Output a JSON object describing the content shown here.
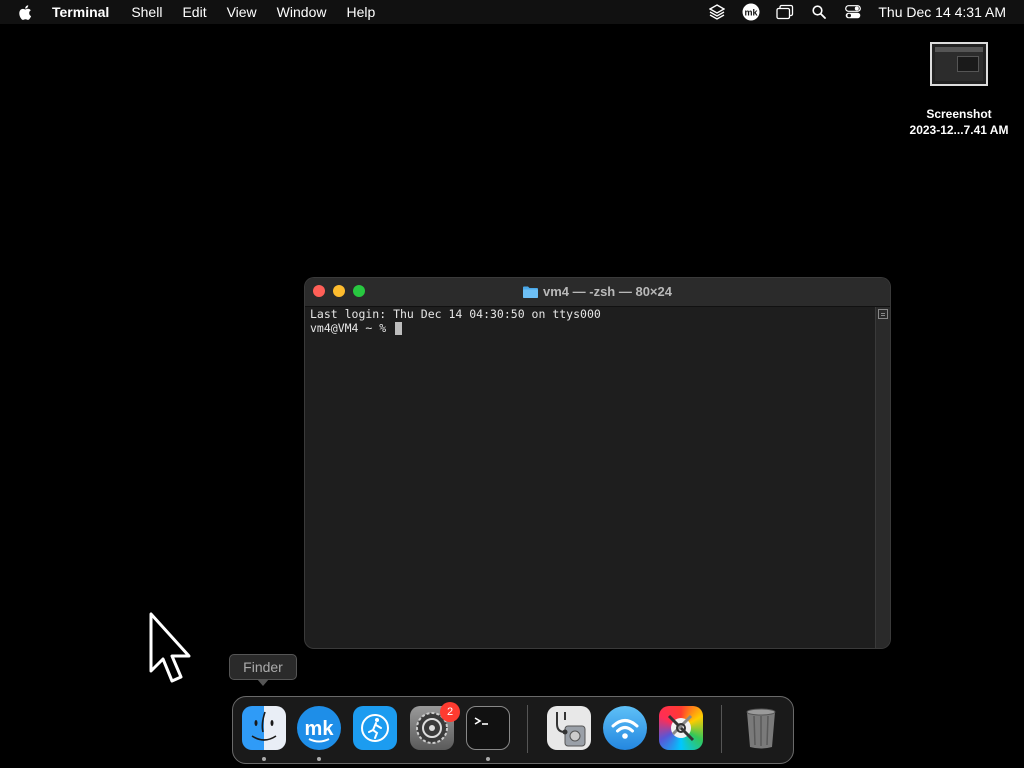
{
  "menubar": {
    "app_name": "Terminal",
    "items": [
      "Shell",
      "Edit",
      "View",
      "Window",
      "Help"
    ],
    "clock": "Thu Dec 14  4:31 AM",
    "status_icons": [
      "layers-icon",
      "mk-icon",
      "screen-mirroring-icon",
      "spotlight-search-icon",
      "control-center-icon"
    ]
  },
  "desktop": {
    "file_name_line1": "Screenshot",
    "file_name_line2": "2023-12...7.41 AM"
  },
  "terminal": {
    "title": "vm4 — -zsh — 80×24",
    "lines": [
      "Last login: Thu Dec 14 04:30:50 on ttys000",
      "vm4@VM4 ~ % "
    ]
  },
  "tooltip": {
    "text": "Finder"
  },
  "dock": {
    "apps": [
      "Finder",
      "mk",
      "Fitness",
      "System Settings",
      "Terminal",
      "Disk Utility",
      "Wireless Diagnostics",
      "ColorSync Utility",
      "Trash"
    ],
    "settings_badge": "2"
  },
  "colors": {
    "close": "#ff5f57",
    "minimize": "#febc2e",
    "zoom": "#28c840",
    "badge": "#ff3b30"
  }
}
